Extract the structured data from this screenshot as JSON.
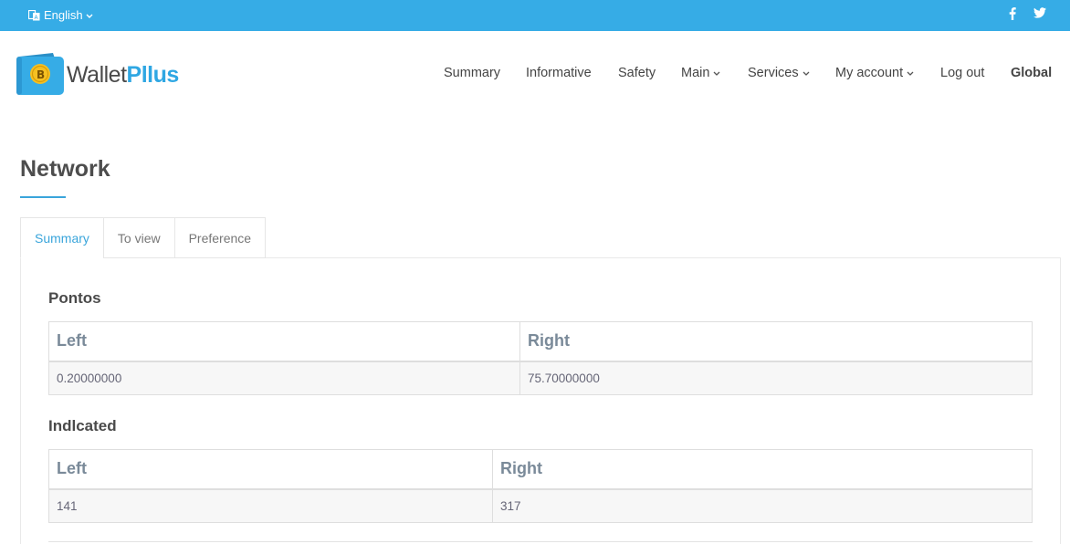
{
  "topbar": {
    "language": "English",
    "social": [
      {
        "name": "facebook-icon",
        "glyph": "f"
      },
      {
        "name": "twitter-icon",
        "glyph": "t"
      }
    ]
  },
  "brand": {
    "name_part1": "Wallet",
    "name_part2": "Pllus",
    "coin_glyph": "B",
    "accent": "#36ace6"
  },
  "nav": {
    "summary": "Summary",
    "informative": "Informative",
    "safety": "Safety",
    "main": "Main",
    "services": "Services",
    "my_account": "My account",
    "log_out": "Log out",
    "global": "Global"
  },
  "page": {
    "title": "Network",
    "tabs": [
      "Summary",
      "To view",
      "Preference"
    ]
  },
  "sections": {
    "pontos": {
      "title": "Pontos",
      "headers": [
        "Left",
        "Right"
      ],
      "row": [
        "0.20000000",
        "75.70000000"
      ]
    },
    "indicated": {
      "title": "Indlcated",
      "headers": [
        "Left",
        "Right"
      ],
      "row": [
        "141",
        "317"
      ]
    }
  }
}
